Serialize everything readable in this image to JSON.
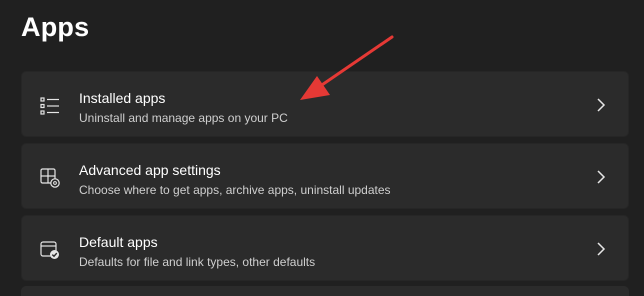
{
  "page": {
    "title": "Apps"
  },
  "items": [
    {
      "title": "Installed apps",
      "description": "Uninstall and manage apps on your PC",
      "icon": "list-icon"
    },
    {
      "title": "Advanced app settings",
      "description": "Choose where to get apps, archive apps, uninstall updates",
      "icon": "app-settings-icon"
    },
    {
      "title": "Default apps",
      "description": "Defaults for file and link types, other defaults",
      "icon": "default-apps-icon"
    }
  ],
  "annotation": {
    "arrow_color": "#e53935"
  },
  "colors": {
    "background": "#202020",
    "card": "#2b2b2b",
    "text": "#ffffff",
    "subtext": "#cfcfcf"
  }
}
